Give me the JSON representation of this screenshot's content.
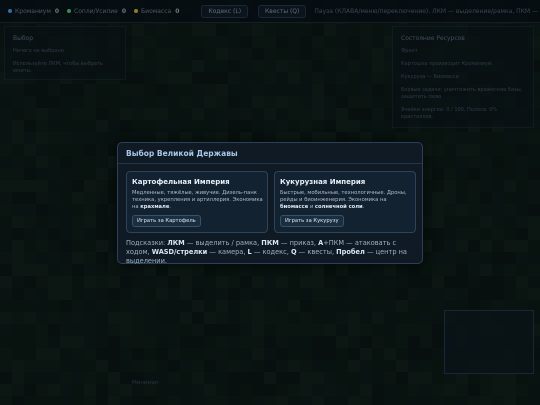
{
  "topbar": {
    "resources": [
      {
        "label": "Кроманиум",
        "value": "0",
        "color": "#4aa3ff"
      },
      {
        "label": "Сопли/Усилие",
        "value": "0",
        "color": "#57d27a"
      },
      {
        "label": "Биомасса",
        "value": "0",
        "color": "#e0b34a"
      }
    ],
    "buttons": [
      "Кодекс (L)",
      "Квесты (Q)"
    ],
    "info": "Пауза (КЛАВА/меню/переключение). ЛКМ — выделение/рамка, ПКМ — приказ, A+ПКМ — атака"
  },
  "left_panel": {
    "title": "Выбор",
    "lines": [
      "Ничего не выбрано",
      "Используйте ЛКМ, чтобы выбрать юниты."
    ]
  },
  "right_panel": {
    "title": "Состояние Ресурсов",
    "lines": [
      "Фронт",
      "Картошка производит Кроманиум.",
      "Кукуруза — Биомасса",
      "Боевые задачи: уничтожить вражеские базы, защитить свою",
      "Ячейки энергии: 0 / 100, Полоса: 0% кристаллов."
    ]
  },
  "bottom_label": "Минимап",
  "modal": {
    "title": "Выбор Великой Державы",
    "cards": [
      {
        "title": "Картофельная Империя",
        "desc_before": "Медленные, тяжёлые, живучие. Дизель-панк техника, укрепления и артиллерия. Экономика на ",
        "desc_b1": "крахмале",
        "desc_after": ".",
        "button": "Играть за Картофель"
      },
      {
        "title": "Кукурузная Империя",
        "desc_before": "Быстрые, мобильные, технологичные. Дроны, рейды и биоинженерия. Экономика на ",
        "desc_b1": "биомассе",
        "desc_mid": " и ",
        "desc_b2": "солнечной соли",
        "desc_after": ".",
        "button": "Играть за Кукурузу"
      }
    ],
    "hints": {
      "prefix": "Подсказки: ",
      "k1": "ЛКМ",
      "t1": " — выделить / рамка, ",
      "k2": "ПКМ",
      "t2": " — приказ, ",
      "k3": "A",
      "t3": "+ПКМ — атаковать с ходом,",
      "k4": "WASD/стрелки",
      "t4": " — камера, ",
      "k5": "L",
      "t5": " — кодекс, ",
      "k6": "Q",
      "t6": " — квесты, ",
      "k7": "Пробел",
      "t7": " — центр на выделении."
    }
  }
}
